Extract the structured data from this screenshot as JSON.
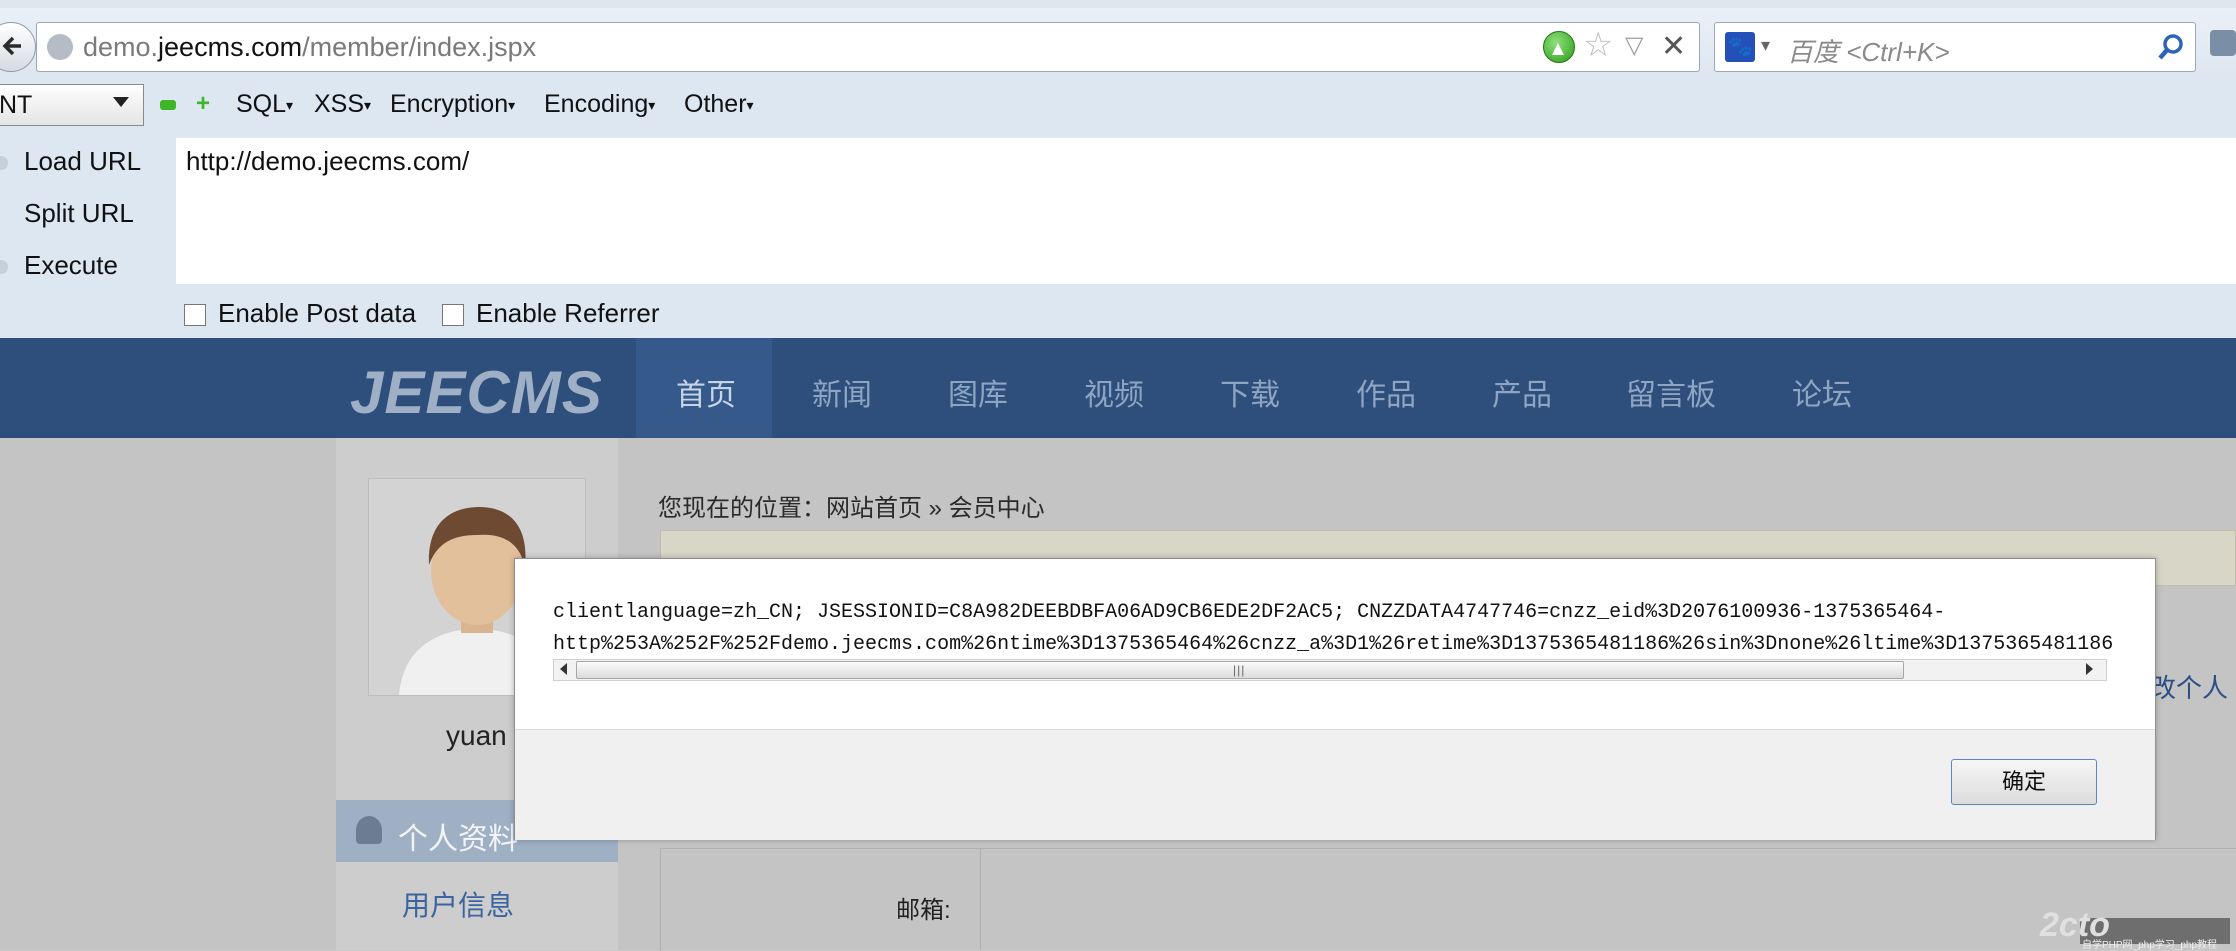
{
  "browser": {
    "url_prefix": "demo.",
    "url_host": "jeecms.com",
    "url_path": "/member/index.jspx",
    "search_placeholder": "百度 <Ctrl+K>"
  },
  "hackbar": {
    "select_value": "NT",
    "menus": [
      "SQL",
      "XSS",
      "Encryption",
      "Encoding",
      "Other"
    ],
    "load_url": "Load URL",
    "split_url": "Split URL",
    "execute": "Execute",
    "url_value": "http://demo.jeecms.com/",
    "enable_post": "Enable Post data",
    "enable_referrer": "Enable Referrer"
  },
  "site": {
    "logo": "JEECMS",
    "nav": [
      "首页",
      "新闻",
      "图库",
      "视频",
      "下载",
      "作品",
      "产品",
      "留言板",
      "论坛"
    ],
    "username": "yuan",
    "profile_title": "个人资料",
    "user_info": "用户信息",
    "breadcrumb": "您现在的位置：网站首页 » 会员中心",
    "edit_link": "改个人",
    "email_label": "邮箱:"
  },
  "dialog": {
    "cookie_line1": "clientlanguage=zh_CN; JSESSIONID=C8A982DEEBDBFA06AD9CB6EDE2DF2AC5; CNZZDATA4747746=cnzz_eid%3D2076100936-1375365464-",
    "cookie_line2": "http%253A%252F%252Fdemo.jeecms.com%26ntime%3D1375365464%26cnzz_a%3D1%26retime%3D1375365481186%26sin%3Dnone%26ltime%3D1375365481186",
    "ok_label": "确定"
  },
  "watermark": {
    "logo": "2cto",
    "text": "自学PHP网_php学习_php教程"
  },
  "colors": {
    "nav_bg": "#2e4f7c",
    "hackbar_bg": "#dde7f2",
    "link": "#3b64a0"
  }
}
